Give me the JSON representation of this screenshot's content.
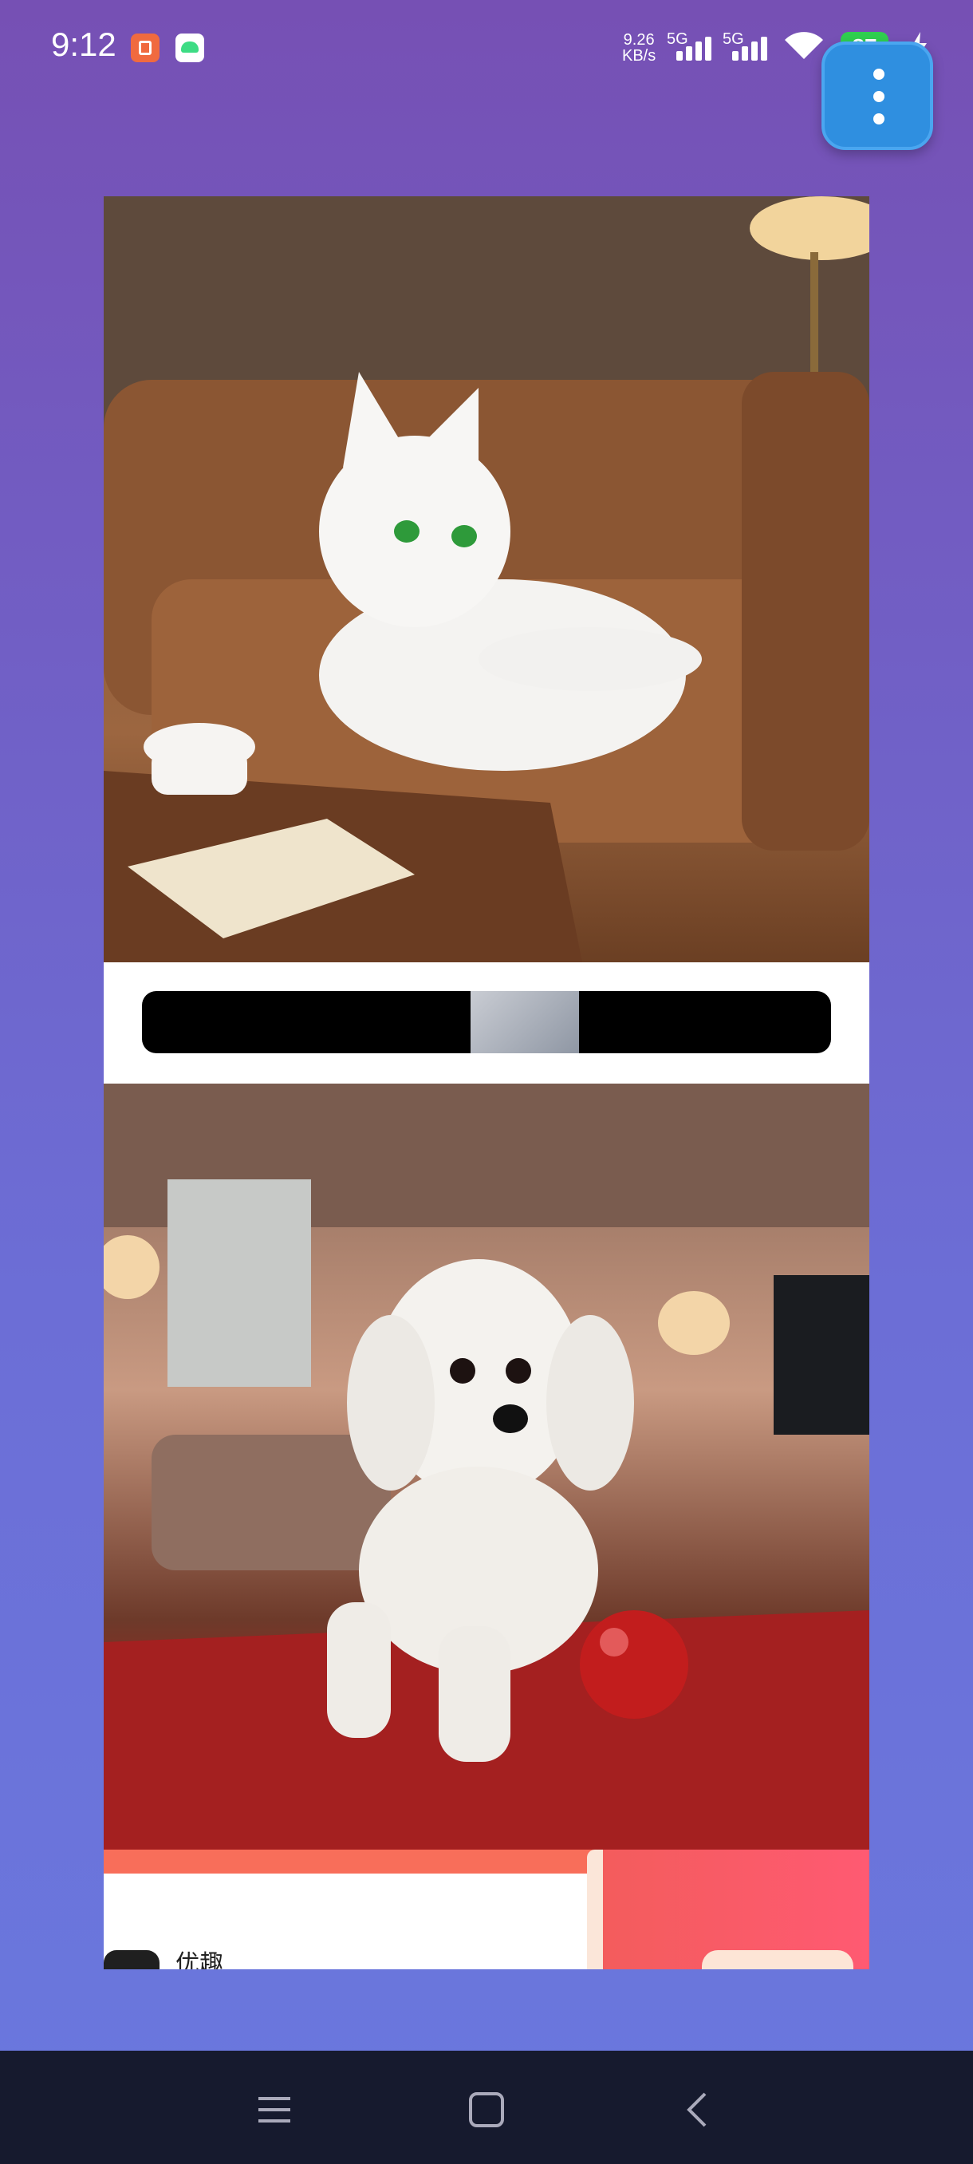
{
  "status_bar": {
    "time": "9:12",
    "net_speed_value": "9.26",
    "net_speed_unit": "KB/s",
    "signal_1": "5G",
    "signal_2": "5G",
    "battery": "87",
    "icons": [
      "notification-app-icon",
      "android-icon",
      "signal-icon",
      "wifi-icon",
      "battery-icon",
      "charging-icon"
    ]
  },
  "menu_button": {
    "icon": "more-vert-icon"
  },
  "feed": {
    "items": [
      {
        "type": "image",
        "subject": "white-cat-on-sofa"
      },
      {
        "type": "ad-banner"
      },
      {
        "type": "image",
        "subject": "white-poodle-with-red-ball"
      }
    ],
    "bottom_card": {
      "app_label": "优趣"
    }
  },
  "nav_bar": {
    "buttons": [
      "menu-icon",
      "home-icon",
      "back-icon"
    ]
  },
  "colors": {
    "accent": "#2f8fe0",
    "battery": "#2fcf4f",
    "navbar": "#161a2e"
  }
}
